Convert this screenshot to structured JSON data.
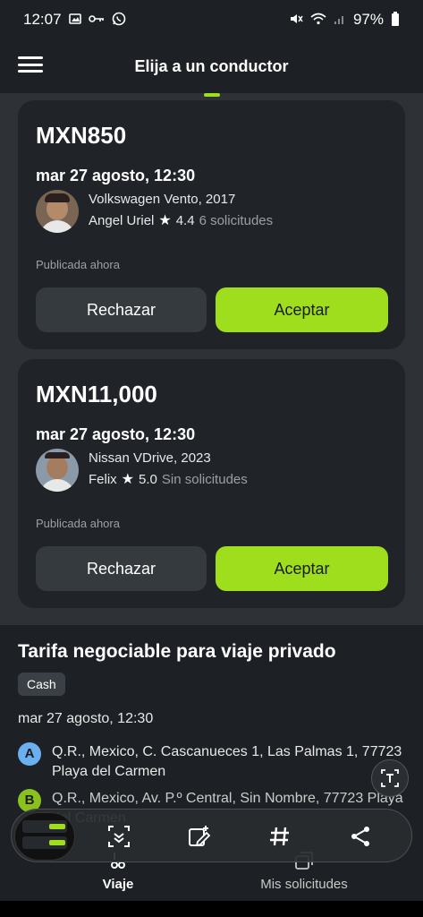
{
  "status_bar": {
    "time": "12:07",
    "battery": "97%",
    "left_icons": [
      "image-icon",
      "key-icon",
      "whatsapp-icon"
    ],
    "right_icons": [
      "mute-icon",
      "wifi-icon",
      "signal-icon",
      "battery-icon"
    ]
  },
  "header": {
    "title": "Elija a un conductor",
    "menu_icon": "hamburger-menu-icon"
  },
  "offers": [
    {
      "price": "MXN850",
      "datetime": "mar 27 agosto, 12:30",
      "vehicle": "Volkswagen Vento, 2017",
      "driver_name": "Angel Uriel",
      "rating": "4.4",
      "requests": "6 solicitudes",
      "published": "Publicada ahora",
      "reject_label": "Rechazar",
      "accept_label": "Aceptar"
    },
    {
      "price": "MXN11,000",
      "datetime": "mar 27 agosto, 12:30",
      "vehicle": "Nissan VDrive, 2023",
      "driver_name": "Felix",
      "rating": "5.0",
      "requests": "Sin solicitudes",
      "published": "Publicada ahora",
      "reject_label": "Rechazar",
      "accept_label": "Aceptar"
    }
  ],
  "trip": {
    "title": "Tarifa negociable para viaje privado",
    "payment": "Cash",
    "date": "mar 27 agosto, 12:30",
    "stops": [
      {
        "marker": "A",
        "address": "Q.R., Mexico, C. Cascanueces 1, Las Palmas 1, 77723 Playa del Carmen"
      },
      {
        "marker": "B",
        "address": "Q.R., Mexico, Av. P.º Central, Sin Nombre, 77723 Playa del Carmen"
      }
    ]
  },
  "bottom_nav": {
    "items": [
      {
        "label": "Viaje",
        "icon": "trip-icon",
        "active": true
      },
      {
        "label": "Mis solicitudes",
        "icon": "requests-icon",
        "active": false
      }
    ]
  },
  "colors": {
    "accent": "#9ede1c",
    "background": "#1d2024",
    "card": "#202428",
    "marker_a": "#6ab0f0"
  }
}
